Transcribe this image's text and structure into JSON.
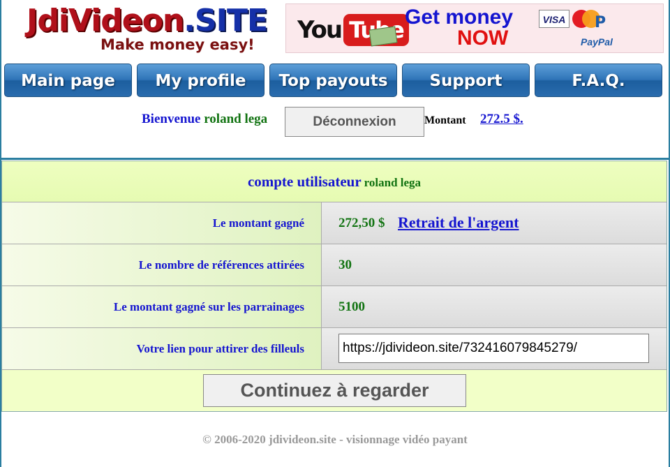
{
  "header": {
    "logo_title": "JdiVideon",
    "logo_title_site": ".SITE",
    "logo_tagline": "Make money easy!",
    "banner": {
      "you": "You",
      "tube": "Tube",
      "headline": "Get money",
      "headline_emphasis": "NOW",
      "visa": "VISA",
      "paypal": "PayPal"
    }
  },
  "nav": {
    "items": [
      {
        "label": "Main page"
      },
      {
        "label": "My profile"
      },
      {
        "label": "Top payouts"
      },
      {
        "label": "Support"
      },
      {
        "label": "F.A.Q."
      }
    ]
  },
  "welcome": {
    "greeting": "Bienvenue",
    "username": "roland lega",
    "logout_label": "Déconnexion",
    "balance_label": "Montant",
    "balance_value": "272.5 $."
  },
  "account": {
    "title": "compte utilisateur",
    "username": "roland lega",
    "rows": [
      {
        "label": "Le montant gagné",
        "value": "272,50 $",
        "link": "Retrait de l'argent"
      },
      {
        "label": "Le nombre de références attirées",
        "value": "30"
      },
      {
        "label": "Le montant gagné sur les parrainages",
        "value": "5100"
      },
      {
        "label": "Votre lien pour attirer des filleuls",
        "input_value": "https://jdivideon.site/732416079845279/"
      }
    ],
    "continue_label": "Continuez à regarder"
  },
  "footer": {
    "text": "© 2006-2020 jdivideon.site - visionnage vidéo payant"
  },
  "colors": {
    "nav_blue": "#2f74b8",
    "text_blue": "#1515d0",
    "text_green": "#117311",
    "panel_bg": "#f2ffc8",
    "frame": "#2a7ea0"
  }
}
